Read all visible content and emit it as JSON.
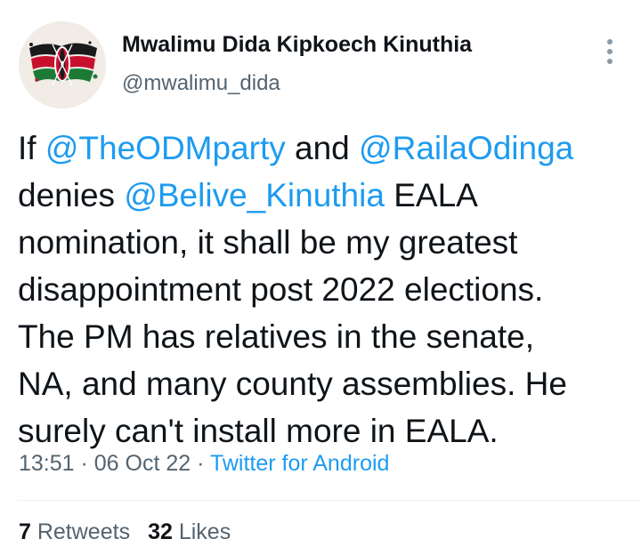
{
  "author": {
    "display_name": "Mwalimu Dida Kipkoech Kinuthia",
    "handle": "@mwalimu_dida",
    "avatar_icon": "kenya-flag-shield-icon"
  },
  "tweet": {
    "lines": [
      [
        {
          "text": "If ",
          "type": "text"
        },
        {
          "text": "@TheODMparty",
          "type": "mention"
        },
        {
          "text": " and ",
          "type": "text"
        },
        {
          "text": "@RailaOdinga",
          "type": "mention"
        }
      ],
      [
        {
          "text": "denies ",
          "type": "text"
        },
        {
          "text": "@Belive_Kinuthia",
          "type": "mention"
        },
        {
          "text": " EALA",
          "type": "text"
        }
      ],
      [
        {
          "text": "nomination, it shall be my greatest",
          "type": "text"
        }
      ],
      [
        {
          "text": "disappointment post 2022 elections.",
          "type": "text"
        }
      ],
      [
        {
          "text": "The PM has relatives in the senate,",
          "type": "text"
        }
      ],
      [
        {
          "text": "NA, and many county assemblies. He",
          "type": "text"
        }
      ],
      [
        {
          "text": "surely can't install more in EALA.",
          "type": "text"
        }
      ]
    ]
  },
  "meta": {
    "time": "13:51",
    "separator": " · ",
    "date": "06 Oct 22",
    "source": "Twitter for Android"
  },
  "stats": {
    "retweets_count": "7",
    "retweets_label": " Retweets",
    "likes_count": "32",
    "likes_label": " Likes"
  },
  "colors": {
    "link": "#1d9bf0",
    "secondary_text": "#536471",
    "primary_text": "#0f1419"
  }
}
